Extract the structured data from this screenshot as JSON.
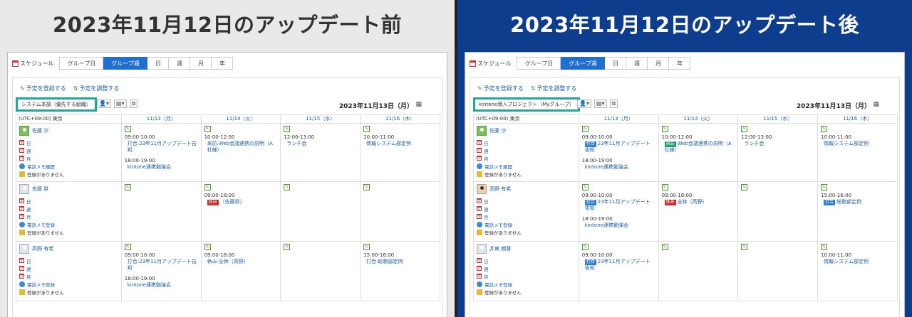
{
  "left": {
    "banner": "2023年11月12日のアップデート前",
    "schedule_label": "スケジュール",
    "tabs": [
      "グループ日",
      "グループ週",
      "日",
      "週",
      "月",
      "年"
    ],
    "active_tab": "グループ週",
    "add_label": "予定を登録する",
    "adjust_label": "予定を調整する",
    "group_select": "システム本部（優先する組織）",
    "date_header": "2023年11月13日（月）",
    "timezone": "(UTC+09:00) 東京",
    "days": [
      "11/13（月）",
      "11/14（火）",
      "11/15（水）",
      "11/16（木）"
    ],
    "users": [
      {
        "name": "佐藤 汐",
        "links": [
          "日",
          "週",
          "月",
          "電話メモ履歴",
          "登録がありません"
        ],
        "days": [
          [
            {
              "time": "09:00-10:00",
              "title": "打合:23年11月アップデート告知",
              "badge": ""
            },
            {
              "time": "18:00-19:00",
              "title": "kintone連携勉強会",
              "badge": ""
            }
          ],
          [
            {
              "time": "10:00-12:00",
              "title": "来訪:Web会議連携の説明（A社様）",
              "badge": ""
            }
          ],
          [
            {
              "time": "12:00-13:00",
              "title": "ランチ会",
              "badge": ""
            }
          ],
          [
            {
              "time": "10:00-11:00",
              "title": "情報システム部定例",
              "badge": ""
            }
          ]
        ]
      },
      {
        "name": "佐藤 昇",
        "links": [
          "日",
          "週",
          "月",
          "電話メモ登録",
          "登録がありません"
        ],
        "days": [
          [],
          [
            {
              "time": "09:00-18:00",
              "title": "（佐藤昇）",
              "badge": "休み"
            }
          ],
          [],
          []
        ]
      },
      {
        "name": "高野 有希",
        "links": [
          "日",
          "週",
          "月",
          "電話メモ登録",
          "登録がありません"
        ],
        "days": [
          [
            {
              "time": "09:00-10:00",
              "title": "打合:23年11月アップデート告知",
              "badge": ""
            },
            {
              "time": "18:00-19:00",
              "title": "kintone連携勉強会",
              "badge": ""
            }
          ],
          [
            {
              "time": "09:00-18:00",
              "title": "休み:全休（高野）",
              "badge": ""
            }
          ],
          [],
          [
            {
              "time": "15:00-16:00",
              "title": "打合:総務部定例",
              "badge": ""
            }
          ]
        ]
      }
    ]
  },
  "right": {
    "banner": "2023年11月12日のアップデート後",
    "schedule_label": "スケジュール",
    "tabs": [
      "グループ日",
      "グループ週",
      "日",
      "週",
      "月",
      "年"
    ],
    "active_tab": "グループ週",
    "add_label": "予定を登録する",
    "adjust_label": "予定を調整する",
    "group_select": "kintone導入プロジェクト（Myグループ）",
    "date_header": "2023年11月13日（月）",
    "timezone": "(UTC+09:00) 東京",
    "days": [
      "11/13（月）",
      "11/14（火）",
      "11/15（水）",
      "11/16（木）"
    ],
    "users": [
      {
        "name": "佐藤 汐",
        "links": [
          "日",
          "週",
          "月",
          "電話メモ履歴",
          "登録がありません"
        ],
        "days": [
          [
            {
              "time": "09:00-10:00",
              "title": "23年11月アップデート告知",
              "badge": "打合"
            },
            {
              "time": "18:00-19:00",
              "title": "kintone連携勉強会",
              "badge": ""
            }
          ],
          [
            {
              "time": "10:00-12:00",
              "title": "Web会議連携の説明（A社様）",
              "badge": "来訪"
            }
          ],
          [
            {
              "time": "12:00-13:00",
              "title": "ランチ会",
              "badge": ""
            }
          ],
          [
            {
              "time": "10:00-11:00",
              "title": "情報システム部定例",
              "badge": ""
            }
          ]
        ]
      },
      {
        "name": "高野 有希",
        "links": [
          "日",
          "週",
          "月",
          "電話メモ登録",
          "登録がありません"
        ],
        "days": [
          [
            {
              "time": "09:00-10:00",
              "title": "23年11月アップデート告知",
              "badge": "打合"
            },
            {
              "time": "18:00-19:00",
              "title": "kintone連携勉強会",
              "badge": ""
            }
          ],
          [
            {
              "time": "09:00-18:00",
              "title": "全休（高野）",
              "badge": "休み"
            }
          ],
          [],
          [
            {
              "time": "15:00-16:00",
              "title": "総務部定例",
              "badge": "打合"
            }
          ]
        ]
      },
      {
        "name": "井東 朗督",
        "links": [
          "日",
          "週",
          "月",
          "電話メモ登録",
          "登録がありません"
        ],
        "days": [
          [
            {
              "time": "09:00-10:00",
              "title": "23年11月アップデート告知",
              "badge": "打合"
            }
          ],
          [],
          [],
          [
            {
              "time": "10:00-11:00",
              "title": "情報システム部定例",
              "badge": ""
            }
          ]
        ]
      }
    ]
  },
  "colors": {
    "left_banner_bg": "#e9e9e9",
    "right_banner_bg": "#0d3d8c",
    "active_tab": "#1e6fd0",
    "selector_border": "#1fa99a",
    "badge_meeting": "#2f7fd0",
    "badge_off": "#d02a2a",
    "badge_visit": "#1aa06e"
  }
}
